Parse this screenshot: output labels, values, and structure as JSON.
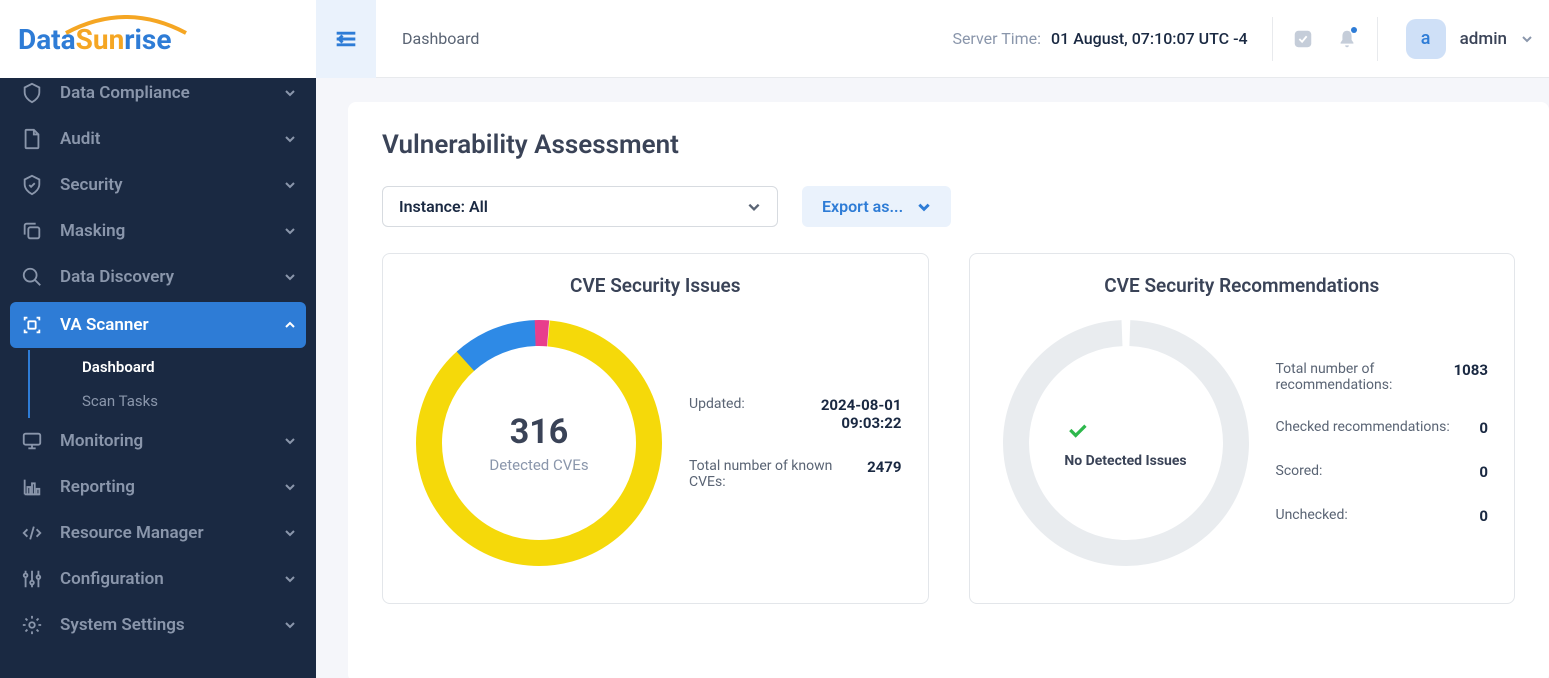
{
  "logo": {
    "part1": "Data",
    "part2": "Sun",
    "part3": "rise"
  },
  "breadcrumb": "Dashboard",
  "server_time": {
    "label": "Server Time:",
    "value": "01 August, 07:10:07  UTC -4"
  },
  "user": {
    "initial": "a",
    "name": "admin"
  },
  "sidebar": {
    "items": [
      {
        "label": "Data Compliance"
      },
      {
        "label": "Audit"
      },
      {
        "label": "Security"
      },
      {
        "label": "Masking"
      },
      {
        "label": "Data Discovery"
      },
      {
        "label": "VA Scanner"
      },
      {
        "label": "Monitoring"
      },
      {
        "label": "Reporting"
      },
      {
        "label": "Resource Manager"
      },
      {
        "label": "Configuration"
      },
      {
        "label": "System Settings"
      }
    ],
    "va_sub": [
      {
        "label": "Dashboard"
      },
      {
        "label": "Scan Tasks"
      }
    ]
  },
  "page": {
    "title": "Vulnerability Assessment",
    "instance_select": "Instance: All",
    "export_btn": "Export as..."
  },
  "card_cve": {
    "title": "CVE Security Issues",
    "center_num": "316",
    "center_sub": "Detected CVEs",
    "stats": [
      {
        "label": "Updated:",
        "value": "2024-08-01 09:03:22"
      },
      {
        "label": "Total number of known CVEs:",
        "value": "2479"
      }
    ]
  },
  "card_rec": {
    "title": "CVE Security Recommendations",
    "center_msg": "No Detected Issues",
    "stats": [
      {
        "label": "Total number of recommendations:",
        "value": "1083"
      },
      {
        "label": "Checked recommendations:",
        "value": "0"
      },
      {
        "label": "Scored:",
        "value": "0"
      },
      {
        "label": "Unchecked:",
        "value": "0"
      }
    ]
  },
  "chart_data": [
    {
      "type": "pie",
      "title": "CVE Security Issues",
      "total": 316,
      "series": [
        {
          "name": "Yellow",
          "value": 275,
          "color": "#f5d90a"
        },
        {
          "name": "Blue",
          "value": 35,
          "color": "#2e8ae6"
        },
        {
          "name": "Pink",
          "value": 6,
          "color": "#e83e8c"
        }
      ]
    },
    {
      "type": "pie",
      "title": "CVE Security Recommendations",
      "total": 0,
      "series": [
        {
          "name": "None",
          "value": 0,
          "color": "#e3e6ea"
        }
      ]
    }
  ]
}
